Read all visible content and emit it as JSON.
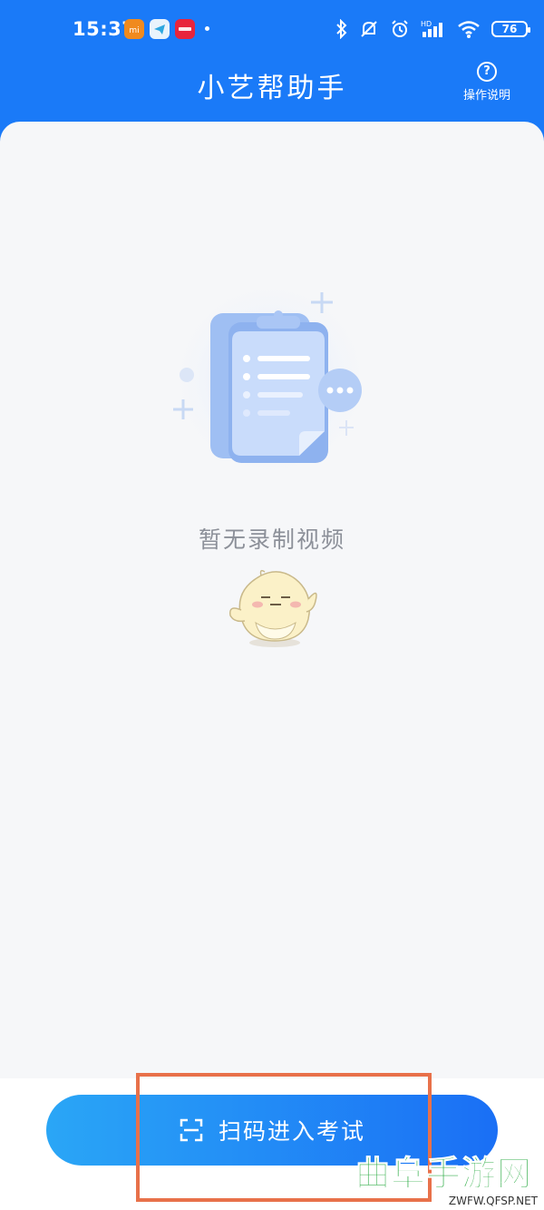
{
  "status_bar": {
    "time": "15:37",
    "app_icons": [
      {
        "name": "mi-app-icon",
        "color": "#f08a1e",
        "label": "mi"
      },
      {
        "name": "telegram-app-icon",
        "color": "#2ea7e0",
        "label": ""
      },
      {
        "name": "xiaohongshu-app-icon",
        "color": "#e8243c",
        "label": "小红书"
      }
    ],
    "battery": "76",
    "network": "HD"
  },
  "header": {
    "title": "小艺帮助手",
    "help_icon": "?",
    "help_label": "操作说明"
  },
  "empty_state": {
    "message": "暂无录制视频"
  },
  "action": {
    "scan_button_label": "扫码进入考试",
    "scan_icon": "scan-frame-icon"
  },
  "watermark": {
    "main": "曲阜手游网",
    "sub": "ZWFW.QFSP.NET"
  },
  "colors": {
    "header_blue": "#1a7af8",
    "button_gradient_start": "#2aa6f6",
    "button_gradient_end": "#1a6ff5",
    "highlight_orange": "#e8714a",
    "watermark_green": "#23a83c",
    "empty_text_gray": "#8c9099"
  }
}
